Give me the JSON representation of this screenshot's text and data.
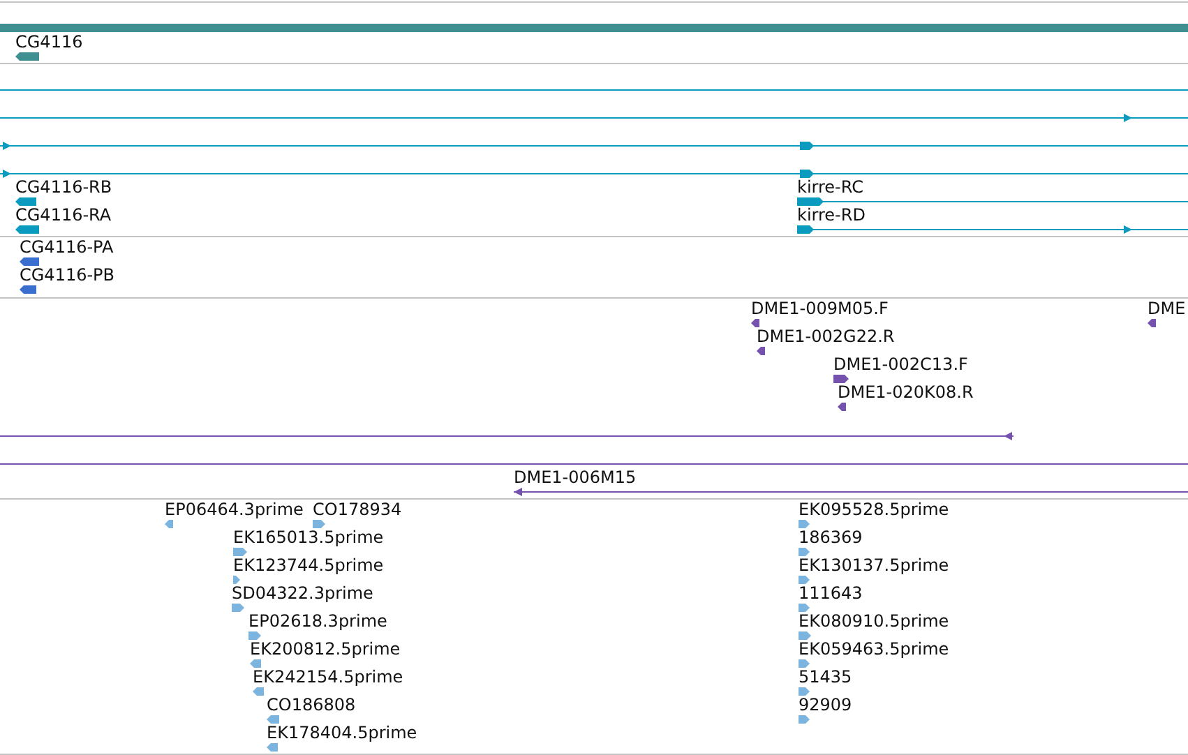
{
  "tracks": [
    {
      "kind": "gene",
      "features": [
        {
          "kind": "bar"
        },
        {
          "kind": "block",
          "label": "CG4116",
          "reverse": true
        }
      ]
    },
    {
      "kind": "transcript",
      "features": [
        {
          "kind": "line"
        },
        {
          "kind": "line",
          "reverse": false
        },
        {
          "kind": "line",
          "reverse": false
        },
        {
          "kind": "line",
          "reverse": false
        },
        {
          "kind": "block",
          "label": "CG4116-RB",
          "reverse": true
        },
        {
          "kind": "block",
          "label": "kirre-RC",
          "reverse": false
        },
        {
          "kind": "block",
          "label": "CG4116-RA",
          "reverse": true
        },
        {
          "kind": "block",
          "label": "kirre-RD",
          "reverse": false
        }
      ]
    },
    {
      "kind": "protein",
      "features": [
        {
          "kind": "block",
          "label": "CG4116-PA",
          "reverse": true
        },
        {
          "kind": "block",
          "label": "CG4116-PB",
          "reverse": true
        }
      ]
    },
    {
      "kind": "clone",
      "features": [
        {
          "kind": "block",
          "label": "DME1-009M05.F",
          "reverse": true
        },
        {
          "kind": "block",
          "label": "DME",
          "reverse": true
        },
        {
          "kind": "block",
          "label": "DME1-002G22.R",
          "reverse": true
        },
        {
          "kind": "block",
          "label": "DME1-002C13.F",
          "reverse": false
        },
        {
          "kind": "block",
          "label": "DME1-020K08.R",
          "reverse": true
        },
        {
          "kind": "line",
          "reverse": true
        },
        {
          "kind": "line"
        },
        {
          "kind": "line",
          "label": "DME1-006M15",
          "reverse": true
        }
      ]
    },
    {
      "kind": "est",
      "features": [
        {
          "kind": "block",
          "label": "EP06464.3prime",
          "reverse": true
        },
        {
          "kind": "block",
          "label": "CO178934",
          "reverse": false
        },
        {
          "kind": "block",
          "label": "EK095528.5prime",
          "reverse": false
        },
        {
          "kind": "block",
          "label": "EK165013.5prime",
          "reverse": false
        },
        {
          "kind": "block",
          "label": "186369",
          "reverse": false
        },
        {
          "kind": "block",
          "label": "EK123744.5prime",
          "reverse": false
        },
        {
          "kind": "block",
          "label": "EK130137.5prime",
          "reverse": false
        },
        {
          "kind": "block",
          "label": "SD04322.3prime",
          "reverse": false
        },
        {
          "kind": "block",
          "label": "111643",
          "reverse": false
        },
        {
          "kind": "block",
          "label": "EP02618.3prime",
          "reverse": false
        },
        {
          "kind": "block",
          "label": "EK080910.5prime",
          "reverse": false
        },
        {
          "kind": "block",
          "label": "EK200812.5prime",
          "reverse": true
        },
        {
          "kind": "block",
          "label": "EK059463.5prime",
          "reverse": false
        },
        {
          "kind": "block",
          "label": "EK242154.5prime",
          "reverse": true
        },
        {
          "kind": "block",
          "label": "51435",
          "reverse": false
        },
        {
          "kind": "block",
          "label": "CO186808",
          "reverse": true
        },
        {
          "kind": "block",
          "label": "92909",
          "reverse": false
        },
        {
          "kind": "block",
          "label": "EK178404.5prime",
          "reverse": true
        }
      ]
    }
  ]
}
